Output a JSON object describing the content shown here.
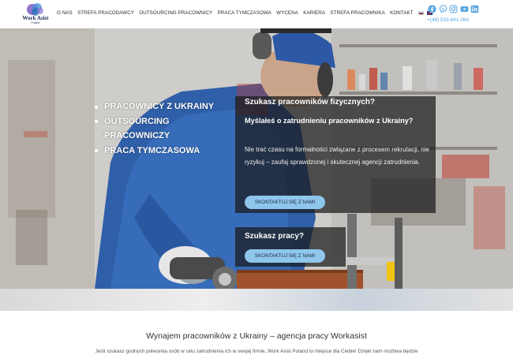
{
  "header": {
    "logo_name": "Work Asist",
    "logo_sub": "Poland",
    "nav": [
      "O NAS",
      "STREFA PRACODAWCY",
      "OUTSOURCING PRACOWNICY",
      "PRACA TYMCZASOWA",
      "WYCENA",
      "KARIERA",
      "STREFA PRACOWNIKA",
      "KONTAKT"
    ],
    "languages": [
      "ru-flag-icon",
      "en-flag-icon"
    ],
    "socials": [
      "facebook-icon",
      "viber-icon",
      "instagram-icon",
      "youtube-icon",
      "linkedin-icon"
    ],
    "phone": "+(48) 533-641-064",
    "accent_color": "#5aa7e0"
  },
  "hero": {
    "bullets": [
      "PRACOWNICY Z UKRAINY",
      "OUTSOURCING PRACOWNICZY",
      "PRACA TYMCZASOWA"
    ],
    "question_1": "Szukasz pracowników fizycznych?",
    "question_2": "Myślałeś o zatrudnieniu pracowników z Ukrainy?",
    "description": "Nie trać czasu na formalności związane z procesem rekrutacji, nie ryzykuj – zaufaj sprawdzonej i skutecznej agencji zatrudnienia.",
    "cta_label": "SKONTAKTUJ SIĘ Z NAMI",
    "question_3": "Szukasz pracy?",
    "cta2_label": "SKONTAKTUJ SIĘ Z NAMI",
    "button_color": "#8ec6ec"
  },
  "content": {
    "title": "Wynajem pracowników z Ukrainy – agencja pracy Workasist",
    "text": "Jeśli szukasz godnych polecenia osób w celu zatrudnienia ich w swojej firmie, Work Asist Poland to miejsce dla Ciebie! Dzięki nam możliwa będzie"
  }
}
